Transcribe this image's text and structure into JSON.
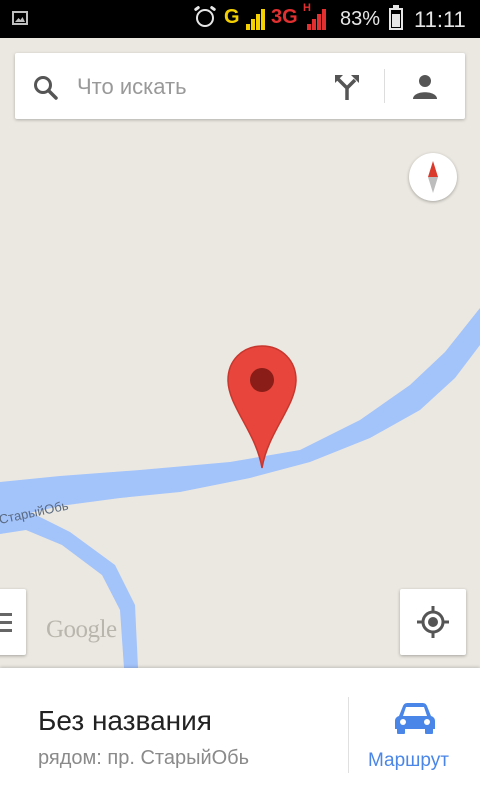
{
  "statusbar": {
    "network_g": "G",
    "network_3g": "3G",
    "network_h": "H",
    "battery": "83%",
    "time": "11:11",
    "icons": [
      "image-notification-icon",
      "alarm-icon",
      "signal-icon",
      "battery-icon"
    ]
  },
  "search": {
    "placeholder": "Что искать"
  },
  "map": {
    "river_label": "СтарыйОбь",
    "logo": "Google"
  },
  "place": {
    "title": "Без названия",
    "subtitle": "рядом: пр. СтарыйОбь"
  },
  "route": {
    "label": "Маршрут"
  },
  "colors": {
    "map_bg": "#ebe8e1",
    "river": "#a3c3fb",
    "pin": "#e8453c",
    "accent": "#4a86e8"
  }
}
